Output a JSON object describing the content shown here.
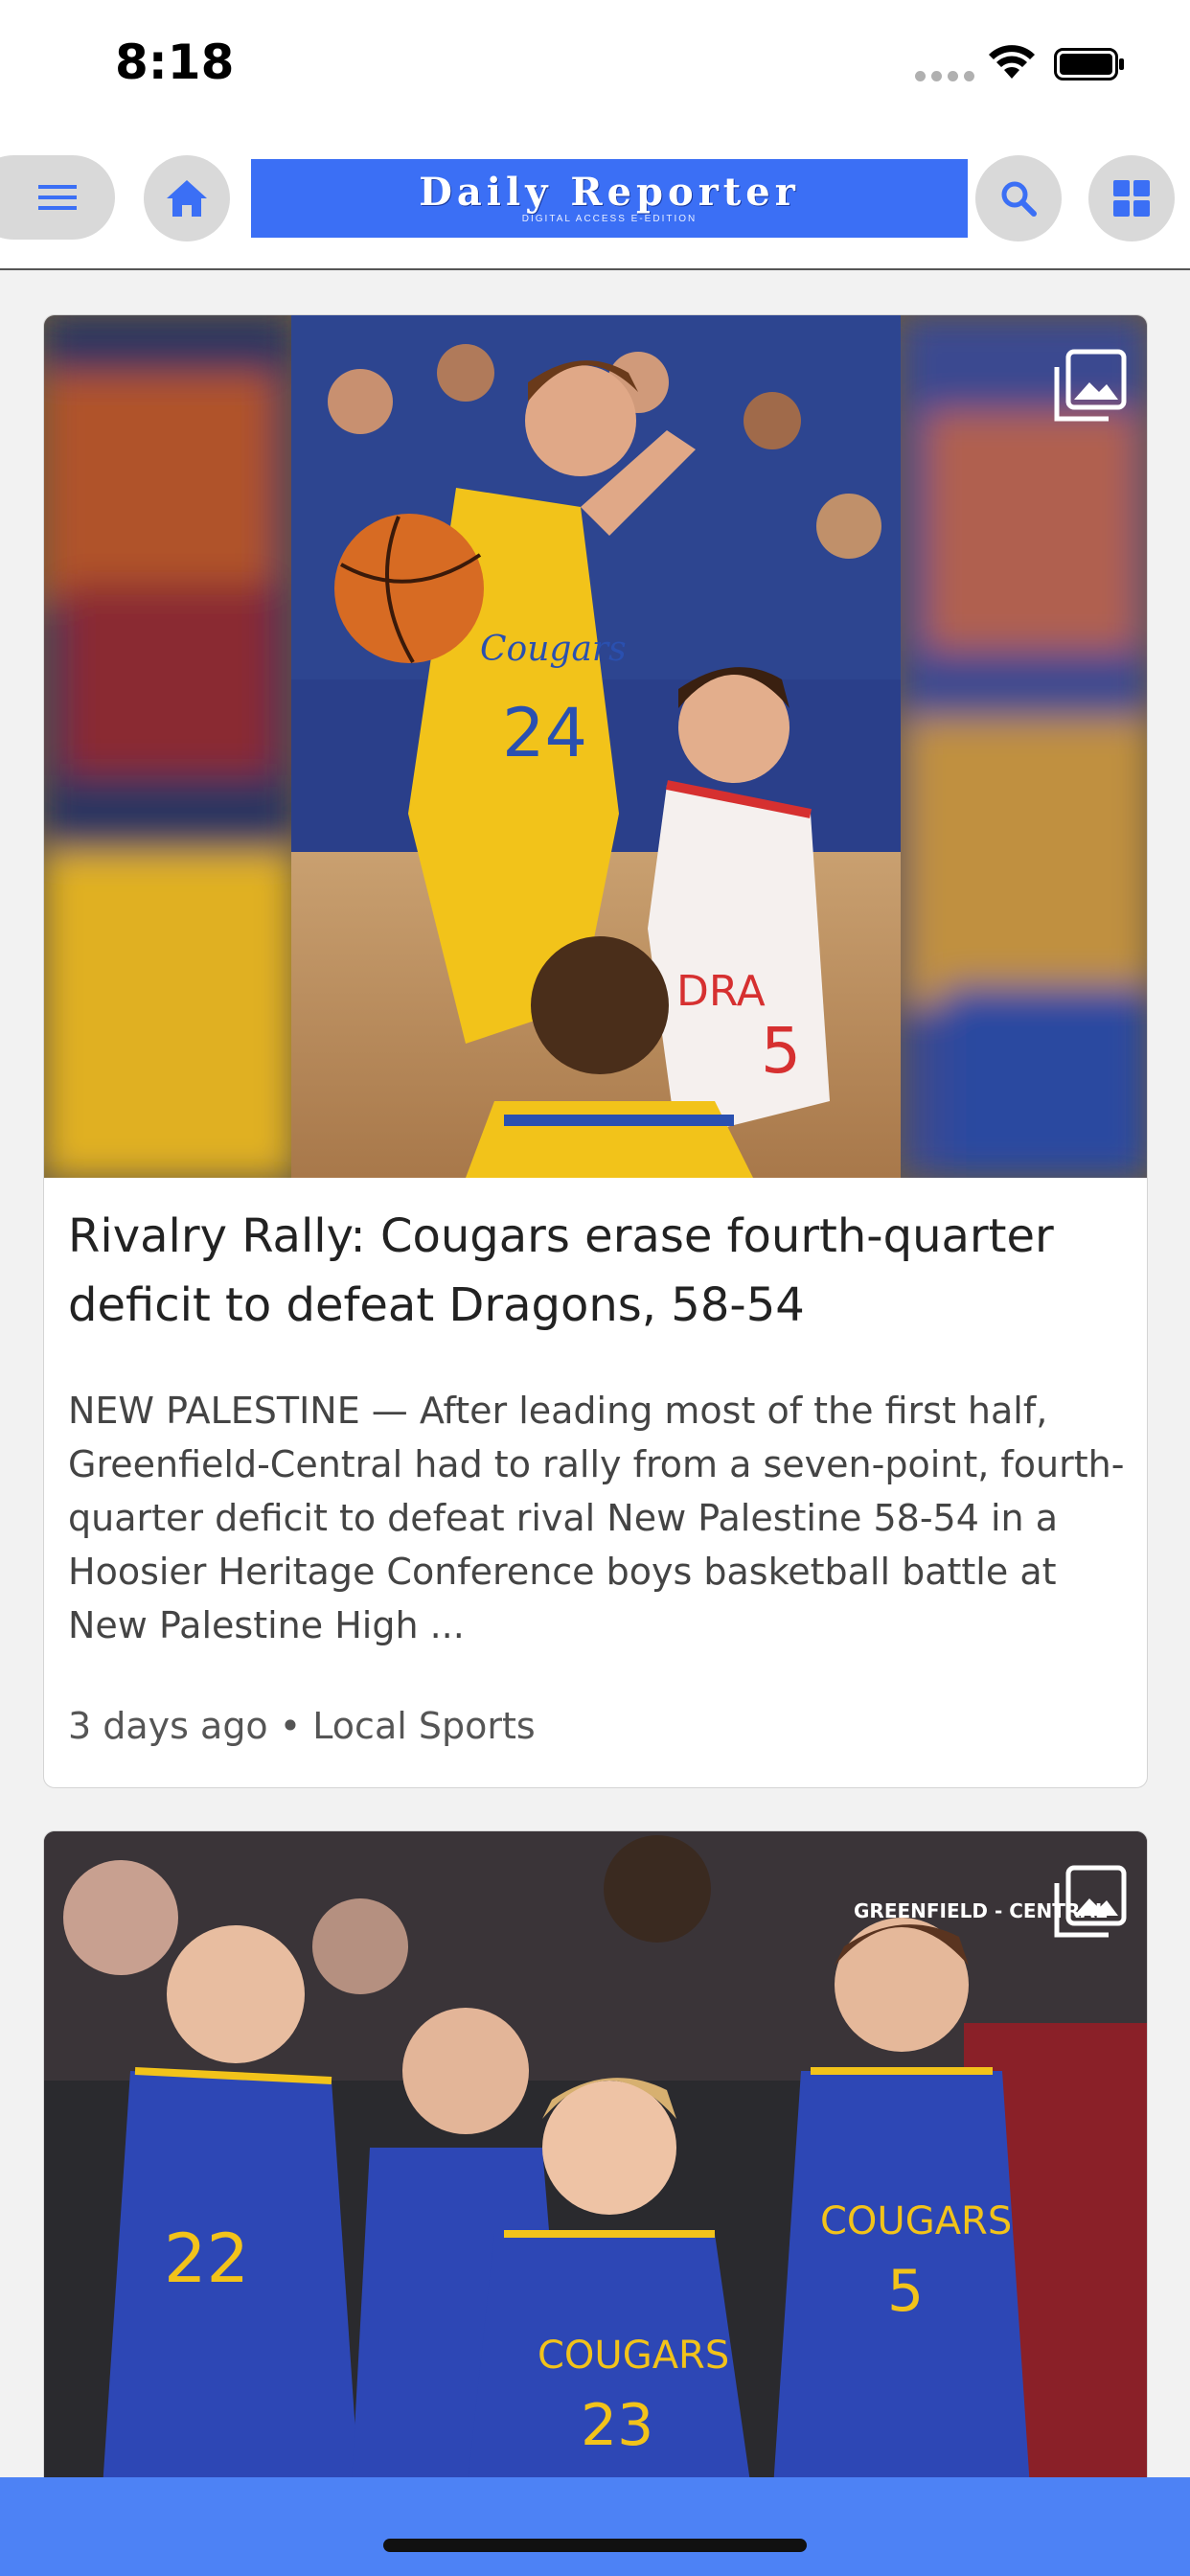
{
  "status_bar": {
    "time": "8:18"
  },
  "header": {
    "masthead_title": "Daily Reporter",
    "masthead_subtitle": "DIGITAL ACCESS E-EDITION",
    "icons": [
      "menu-icon",
      "home-icon",
      "search-icon",
      "grid-icon"
    ],
    "accent_color": "#3b6ff5"
  },
  "articles": [
    {
      "title": "Rivalry Rally: Cougars erase fourth-quarter deficit to defeat Dragons, 58-54",
      "summary": "NEW PALESTINE — After leading most of the first half, Greenfield-Central had to rally from a seven-point, fourth-quarter deficit to defeat rival New Palestine 58-54 in a Hoosier Heritage Conference boys basketball battle at New Palestine High ...",
      "age": "3 days ago",
      "separator": "•",
      "section": "Local Sports",
      "photo_icon": "gallery-icon"
    },
    {
      "photo_icon": "gallery-icon",
      "photo_banner_text": "GREENFIELD - CENTRAL"
    }
  ],
  "bottom_bar_color": "#4d82f5"
}
